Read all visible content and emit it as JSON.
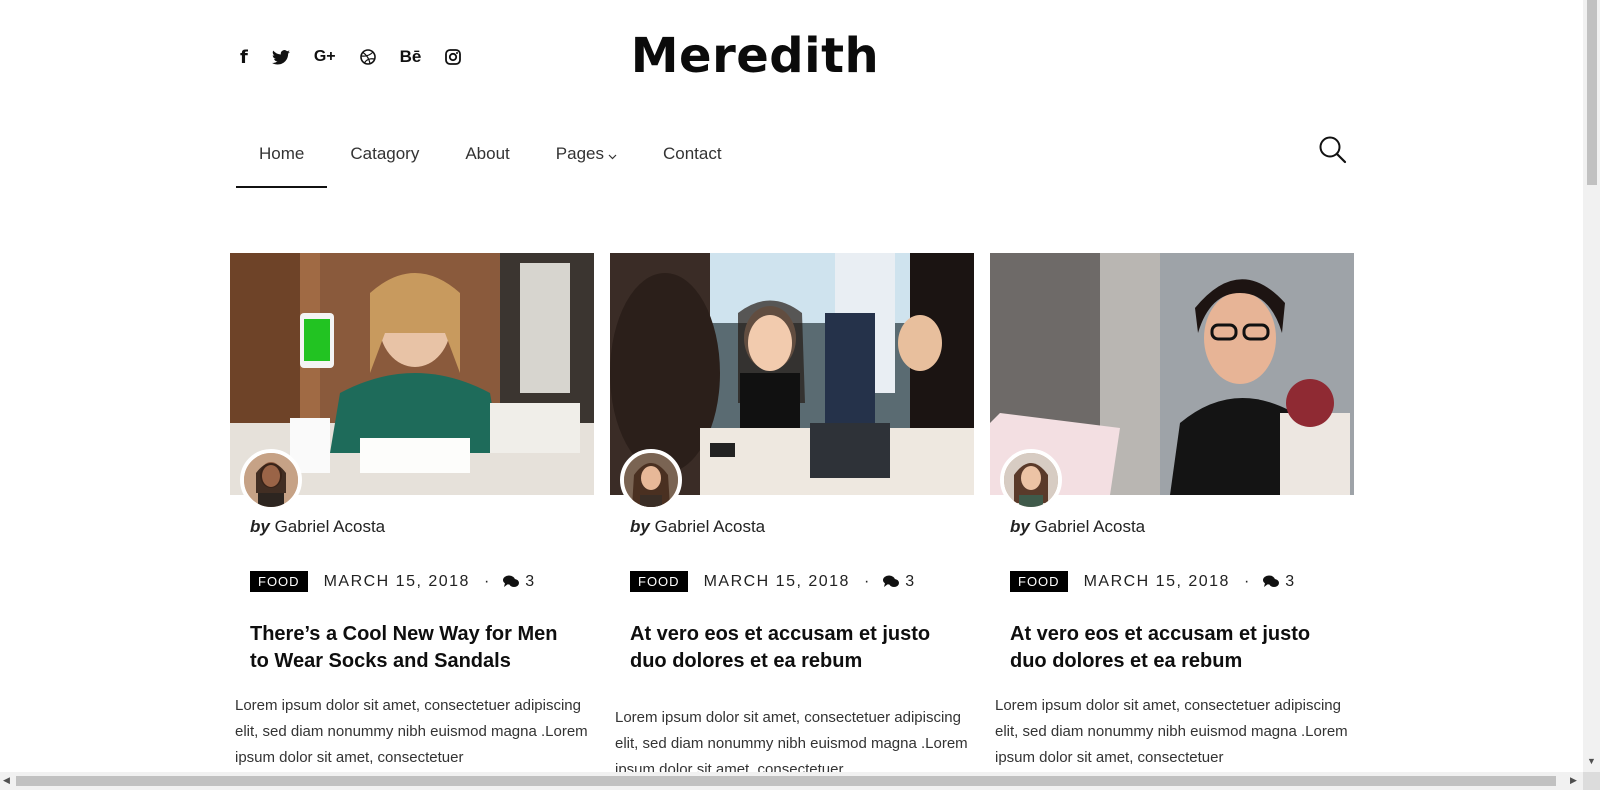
{
  "brand": {
    "name": "Meredith"
  },
  "social": [
    {
      "label": "f",
      "icon": "facebook-icon"
    },
    {
      "label": "",
      "icon": "twitter-icon"
    },
    {
      "label": "G+",
      "icon": "google-plus-icon"
    },
    {
      "label": "",
      "icon": "dribbble-icon"
    },
    {
      "label": "Bē",
      "icon": "behance-icon"
    },
    {
      "label": "",
      "icon": "instagram-icon"
    }
  ],
  "nav": {
    "items": [
      {
        "label": "Home",
        "active": true
      },
      {
        "label": "Catagory"
      },
      {
        "label": "About"
      },
      {
        "label": "Pages",
        "has_dropdown": true
      },
      {
        "label": "Contact"
      }
    ],
    "search_icon": "search-icon"
  },
  "posts": [
    {
      "by": "by",
      "author": "Gabriel Acosta",
      "category": "FOOD",
      "date": "MARCH 15, 2018",
      "separator": "·",
      "comments": "3",
      "title": "There’s a Cool New Way for Men to Wear Socks and Sandals",
      "excerpt": "Lorem ipsum dolor sit amet, consectetuer adipiscing elit, sed diam nonummy nibh euismod magna .Lorem ipsum dolor sit amet, consectetuer"
    },
    {
      "by": "by",
      "author": "Gabriel Acosta",
      "category": "FOOD",
      "date": "MARCH 15, 2018",
      "separator": "·",
      "comments": "3",
      "title": "At vero eos et accusam et justo duo dolores et ea rebum",
      "excerpt": "Lorem ipsum dolor sit amet, consectetuer adipiscing elit, sed diam nonummy nibh euismod magna .Lorem ipsum dolor sit amet, consectetuer"
    },
    {
      "by": "by",
      "author": "Gabriel Acosta",
      "category": "FOOD",
      "date": "MARCH 15, 2018",
      "separator": "·",
      "comments": "3",
      "title": "At vero eos et accusam et justo duo dolores et ea rebum",
      "excerpt": "Lorem ipsum dolor sit amet, consectetuer adipiscing elit, sed diam nonummy nibh euismod magna .Lorem ipsum dolor sit amet, consectetuer"
    }
  ],
  "scrollbars": {
    "vertical_up": "▲",
    "vertical_down": "▼",
    "horizontal_left": "◀",
    "horizontal_right": "▶"
  }
}
